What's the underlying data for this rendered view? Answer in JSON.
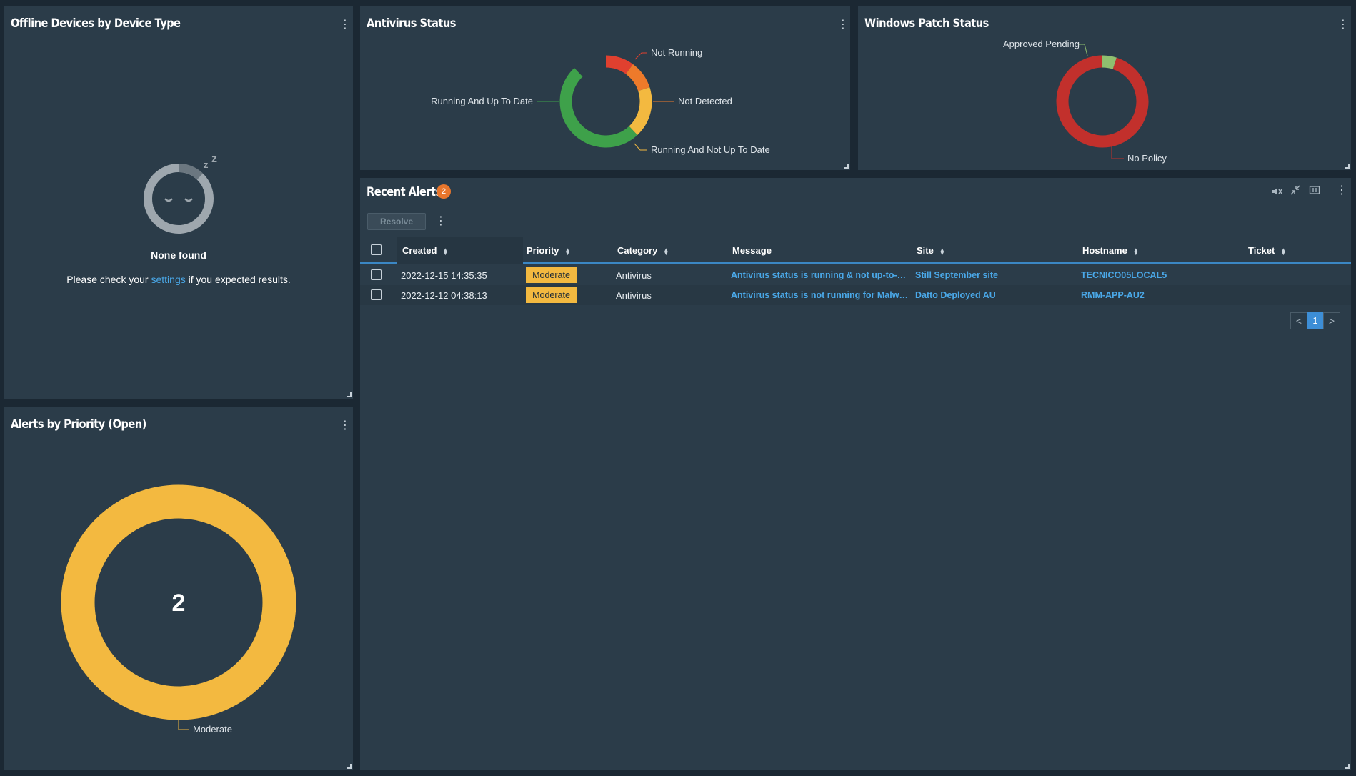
{
  "offline_panel": {
    "title": "Offline Devices by Device Type",
    "empty_title": "None found",
    "empty_msg_before": "Please check your ",
    "empty_msg_link": "settings",
    "empty_msg_after": " if you expected results.",
    "sleep_icon": "sleeping-face-icon"
  },
  "antivirus_panel": {
    "title": "Antivirus Status",
    "chart_data": {
      "type": "pie",
      "donut": true,
      "title": "Antivirus Status",
      "slices": [
        {
          "label": "Not Running",
          "fraction": 0.1,
          "color": "#e0402f"
        },
        {
          "label": "Not Detected",
          "fraction": 0.1,
          "color": "#ee7a2a"
        },
        {
          "label": "Running And Not Up To Date",
          "fraction": 0.18,
          "color": "#f3b940"
        },
        {
          "label": "Running And Up To Date",
          "fraction": 0.5,
          "color": "#3ea14a"
        }
      ]
    }
  },
  "patch_panel": {
    "title": "Windows Patch Status",
    "chart_data": {
      "type": "pie",
      "donut": true,
      "title": "Windows Patch Status",
      "slices": [
        {
          "label": "Approved Pending",
          "fraction": 0.05,
          "color": "#8fbf6f"
        },
        {
          "label": "No Policy",
          "fraction": 0.95,
          "color": "#c2302c"
        }
      ]
    }
  },
  "priority_panel": {
    "title": "Alerts by Priority (Open)",
    "center_value": "2",
    "chart_data": {
      "type": "pie",
      "donut": true,
      "title": "Alerts by Priority (Open)",
      "slices": [
        {
          "label": "Moderate",
          "value": 2,
          "color": "#f3b940"
        }
      ]
    }
  },
  "alerts_panel": {
    "title": "Recent Alerts",
    "badge_count": "2",
    "resolve_label": "Resolve",
    "columns": [
      "Created",
      "Priority",
      "Category",
      "Message",
      "Site",
      "Hostname",
      "Ticket"
    ],
    "rows": [
      {
        "created": "2022-12-15 14:35:35",
        "priority": "Moderate",
        "category": "Antivirus",
        "message": "Antivirus status is running & not up-to-date for Malwarebytes",
        "site": "Still September site",
        "hostname": "TECNICO05LOCAL5",
        "ticket": ""
      },
      {
        "created": "2022-12-12 04:38:13",
        "priority": "Moderate",
        "category": "Antivirus",
        "message": "Antivirus status is not running for Malwarebytes",
        "site": "Datto Deployed AU",
        "hostname": "RMM-APP-AU2",
        "ticket": ""
      }
    ],
    "pager": {
      "prev": "<",
      "current": "1",
      "next": ">"
    },
    "icons": [
      "mute-icon",
      "collapse-icon",
      "columns-icon",
      "kebab-icon"
    ]
  },
  "colors": {
    "background": "#1b2833",
    "panel": "#2b3c49",
    "accent": "#4aa8e8",
    "moderate": "#f3b940",
    "badge": "#e8762c"
  }
}
